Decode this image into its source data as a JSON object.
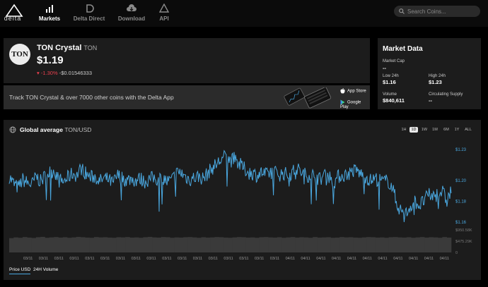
{
  "nav": {
    "logo_text": "delta",
    "items": [
      {
        "label": "Markets",
        "active": true,
        "icon": "chart-bars-icon"
      },
      {
        "label": "Delta Direct",
        "active": false,
        "icon": "delta-direct-icon"
      },
      {
        "label": "Download",
        "active": false,
        "icon": "cloud-download-icon"
      },
      {
        "label": "API",
        "active": false,
        "icon": "api-icon"
      }
    ],
    "search_placeholder": "Search Coins..."
  },
  "coin": {
    "logo_text": "TON",
    "name": "TON Crystal",
    "symbol": "TON",
    "price": "$1.19",
    "change_pct": "-1.30%",
    "change_abs": "-$0.01546333"
  },
  "promo": {
    "text": "Track TON Crystal & over 7000 other coins with the Delta App",
    "app_store": "App Store",
    "google_play": "Google Play"
  },
  "market_data": {
    "title": "Market Data",
    "market_cap_label": "Market Cap",
    "market_cap_value": "--",
    "low_label": "Low 24h",
    "low_value": "$1.16",
    "high_label": "High 24h",
    "high_value": "$1.23",
    "volume_label": "Volume",
    "volume_value": "$840,611",
    "supply_label": "Circulating Supply",
    "supply_value": "--"
  },
  "chart_header": {
    "title": "Global average",
    "pair": "TON/USD",
    "ranges": [
      "1H",
      "1D",
      "1W",
      "1M",
      "6M",
      "1Y",
      "ALL"
    ],
    "selected_range": "1D"
  },
  "tabs": [
    "Price USD",
    "24H Volume"
  ],
  "selected_tab": "Price USD",
  "colors": {
    "accent": "#4aa8e0",
    "negative": "#e8404e",
    "card": "#1c1c1c"
  },
  "chart_data": {
    "type": "line",
    "price_ticks": [
      "$1.23",
      "$1.20",
      "$1.18",
      "$1.16"
    ],
    "ylim": [
      1.16,
      1.23
    ],
    "volume_ticks": [
      "$950.58K",
      "$475.29K",
      "0"
    ],
    "volume_ylim": [
      0,
      950580
    ],
    "x_tick_labels": [
      "03/11",
      "03/11",
      "03/11",
      "03/11",
      "03/11",
      "03/11",
      "03/11",
      "03/11",
      "03/11",
      "03/11",
      "03/11",
      "03/11",
      "03/11",
      "03/11",
      "03/11",
      "03/11",
      "03/11",
      "04/11",
      "04/11",
      "04/11",
      "04/11",
      "04/11",
      "04/11",
      "04/11",
      "04/11",
      "04/11",
      "04/11",
      "04/11"
    ],
    "series": [
      {
        "values": [
          1.204,
          1.197,
          1.193,
          1.201,
          1.198,
          1.196,
          1.204,
          1.199,
          1.205,
          1.208,
          1.21,
          1.2,
          1.199,
          1.203,
          1.207,
          1.205,
          1.212,
          1.207,
          1.203,
          1.204,
          1.199,
          1.202,
          1.201,
          1.197,
          1.205,
          1.203,
          1.2,
          1.202,
          1.2,
          1.202,
          1.199,
          1.201,
          1.203,
          1.201,
          1.203,
          1.199,
          1.2,
          1.207,
          1.208,
          1.204,
          1.201,
          1.203,
          1.204,
          1.202,
          1.207,
          1.212,
          1.216,
          1.22,
          1.224,
          1.219,
          1.221,
          1.216,
          1.212,
          1.208,
          1.207,
          1.205,
          1.208,
          1.205,
          1.209,
          1.208,
          1.206,
          1.207,
          1.205,
          1.209,
          1.211,
          1.207,
          1.205,
          1.206,
          1.204,
          1.201,
          1.207,
          1.204,
          1.198,
          1.204,
          1.205,
          1.206,
          1.209,
          1.21,
          1.206,
          1.204,
          1.2,
          1.202,
          1.201,
          1.199,
          1.2,
          1.193,
          1.177,
          1.17,
          1.168,
          1.176,
          1.18,
          1.176,
          1.181,
          1.186,
          1.185,
          1.187,
          1.19,
          1.18,
          1.191
        ],
        "note": ""
      }
    ],
    "volume_values": [
      0.78,
      0.82,
      0.8,
      0.84,
      0.81,
      0.79,
      0.83,
      0.85,
      0.8,
      0.82,
      0.84,
      0.81,
      0.83,
      0.8,
      0.82,
      0.85,
      0.83,
      0.81,
      0.8,
      0.84,
      0.82,
      0.83,
      0.81,
      0.8,
      0.83,
      0.82,
      0.84,
      0.81,
      0.82,
      0.8,
      0.83,
      0.85,
      0.82,
      0.81,
      0.84,
      0.83,
      0.8,
      0.82,
      0.81,
      0.83,
      0.84,
      0.82,
      0.8,
      0.83,
      0.81,
      0.82,
      0.84,
      0.83,
      0.81,
      0.8,
      0.82,
      0.84,
      0.83,
      0.81,
      0.82,
      0.8,
      0.83,
      0.84,
      0.82,
      0.81,
      0.83,
      0.8,
      0.82,
      0.84,
      0.81,
      0.83,
      0.82,
      0.8,
      0.84,
      0.81,
      0.82,
      0.83,
      0.8,
      0.81,
      0.84,
      0.82,
      0.83,
      0.81,
      0.8,
      0.82,
      0.84,
      0.83,
      0.81,
      0.82,
      0.8,
      0.83,
      0.84,
      0.82,
      0.81,
      0.83,
      0.8,
      0.82,
      0.84,
      0.81,
      0.83,
      0.82,
      0.8,
      0.84,
      0.81
    ]
  }
}
